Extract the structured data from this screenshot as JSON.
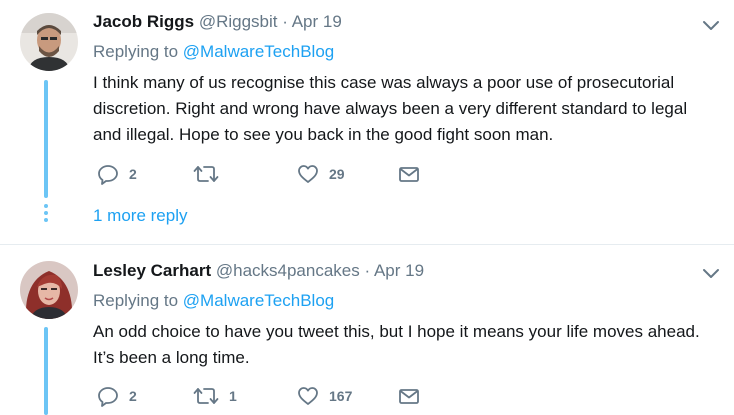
{
  "tweets": [
    {
      "author_name": "Jacob Riggs",
      "author_handle": "@Riggsbit",
      "separator": "·",
      "date": "Apr 19",
      "replying_prefix": "Replying to",
      "replying_to": "@MalwareTechBlog",
      "body_lines": [
        "I think many of us recognise this case was always a poor use of prosecutorial",
        "discretion. Right and wrong have always been a very different standard to legal",
        "and illegal. Hope to see you back in the good fight soon man."
      ],
      "replies": "2",
      "retweets": "",
      "likes": "29",
      "more_replies": "1 more reply"
    },
    {
      "author_name": "Lesley Carhart",
      "author_handle": "@hacks4pancakes",
      "separator": "·",
      "date": "Apr 19",
      "replying_prefix": "Replying to",
      "replying_to": "@MalwareTechBlog",
      "body_lines": [
        "An odd choice to have you tweet this, but I hope it means your life moves ahead.",
        "It’s been a long time."
      ],
      "replies": "2",
      "retweets": "1",
      "likes": "167"
    }
  ],
  "icons": {
    "reply": "reply-icon",
    "retweet": "retweet-icon",
    "like": "heart-icon",
    "dm": "envelope-icon",
    "menu": "chevron-down-icon"
  },
  "colors": {
    "link": "#1da1f2",
    "muted": "#657786",
    "thread": "#6cc5f5",
    "text": "#14171a"
  }
}
